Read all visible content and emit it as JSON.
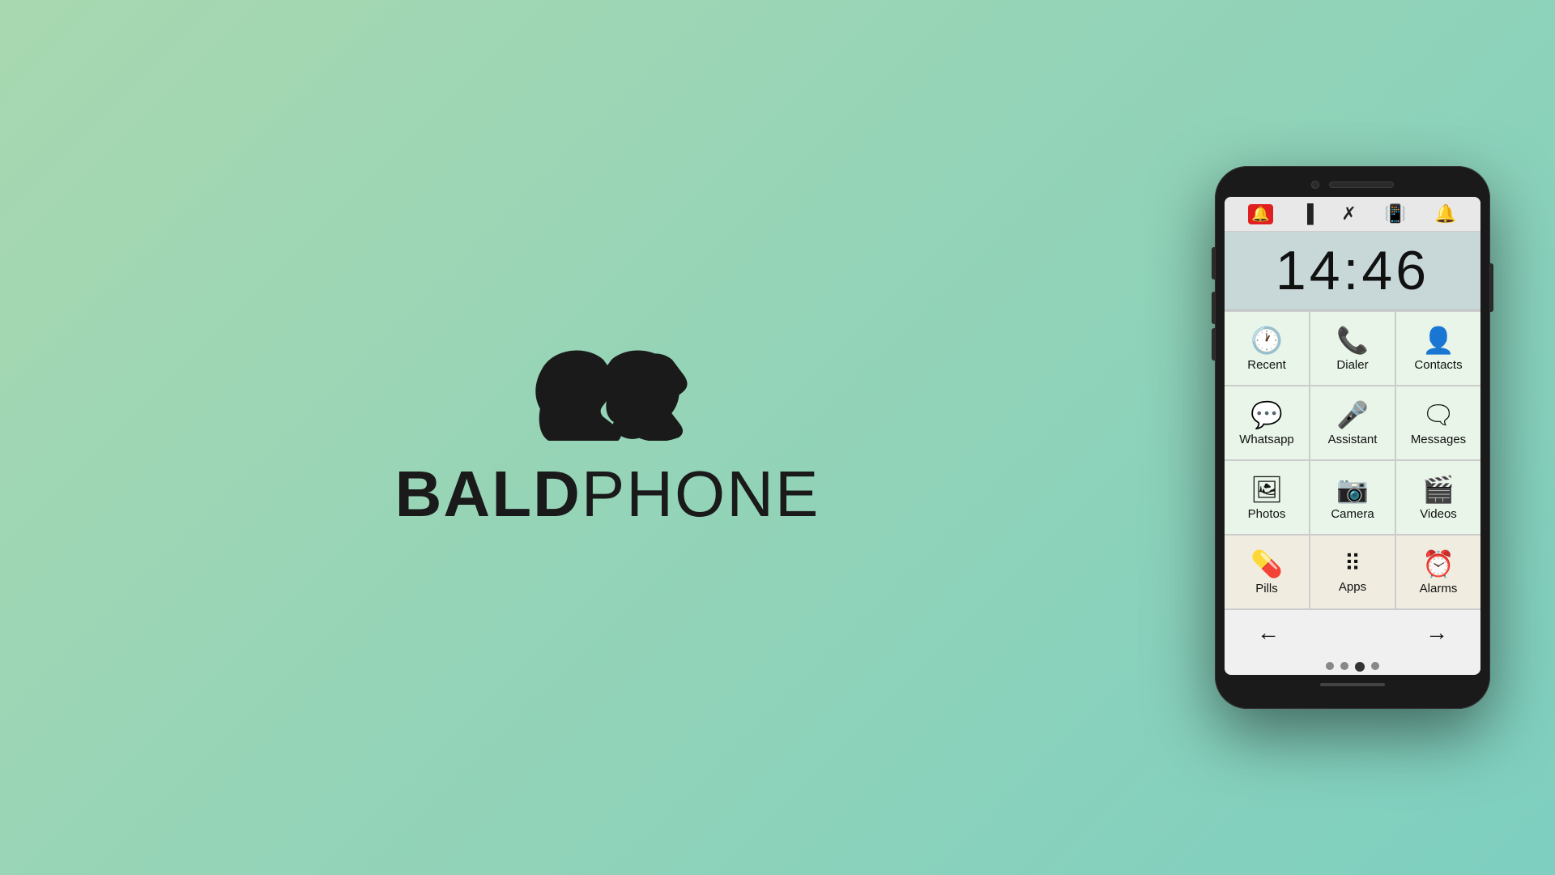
{
  "brand": {
    "bold": "BALD",
    "light": "PHONE"
  },
  "phone": {
    "time": "14:46",
    "status_icons": [
      "🚨",
      "🔋",
      "📵",
      "📳",
      "🔔"
    ],
    "apps": [
      {
        "id": "recent",
        "label": "Recent",
        "icon": "🕐",
        "row": 1,
        "style": "green"
      },
      {
        "id": "dialer",
        "label": "Dialer",
        "icon": "📞",
        "row": 1,
        "style": "green"
      },
      {
        "id": "contacts",
        "label": "Contacts",
        "icon": "👤",
        "row": 1,
        "style": "green"
      },
      {
        "id": "whatsapp",
        "label": "Whatsapp",
        "icon": "💬",
        "row": 2,
        "style": "green"
      },
      {
        "id": "assistant",
        "label": "Assistant",
        "icon": "🎤",
        "row": 2,
        "style": "green"
      },
      {
        "id": "messages",
        "label": "Messages",
        "icon": "💬",
        "row": 2,
        "style": "green"
      },
      {
        "id": "photos",
        "label": "Photos",
        "icon": "🖼",
        "row": 3,
        "style": "green"
      },
      {
        "id": "camera",
        "label": "Camera",
        "icon": "📷",
        "row": 3,
        "style": "green"
      },
      {
        "id": "videos",
        "label": "Videos",
        "icon": "🎬",
        "row": 3,
        "style": "green"
      },
      {
        "id": "pills",
        "label": "Pills",
        "icon": "💊",
        "row": 4,
        "style": "beige"
      },
      {
        "id": "apps",
        "label": "Apps",
        "icon": "⊞",
        "row": 4,
        "style": "beige"
      },
      {
        "id": "alarms",
        "label": "Alarms",
        "icon": "⏰",
        "row": 4,
        "style": "beige"
      }
    ],
    "nav": {
      "back": "←",
      "forward": "→"
    },
    "dots": [
      false,
      false,
      true,
      false
    ]
  }
}
